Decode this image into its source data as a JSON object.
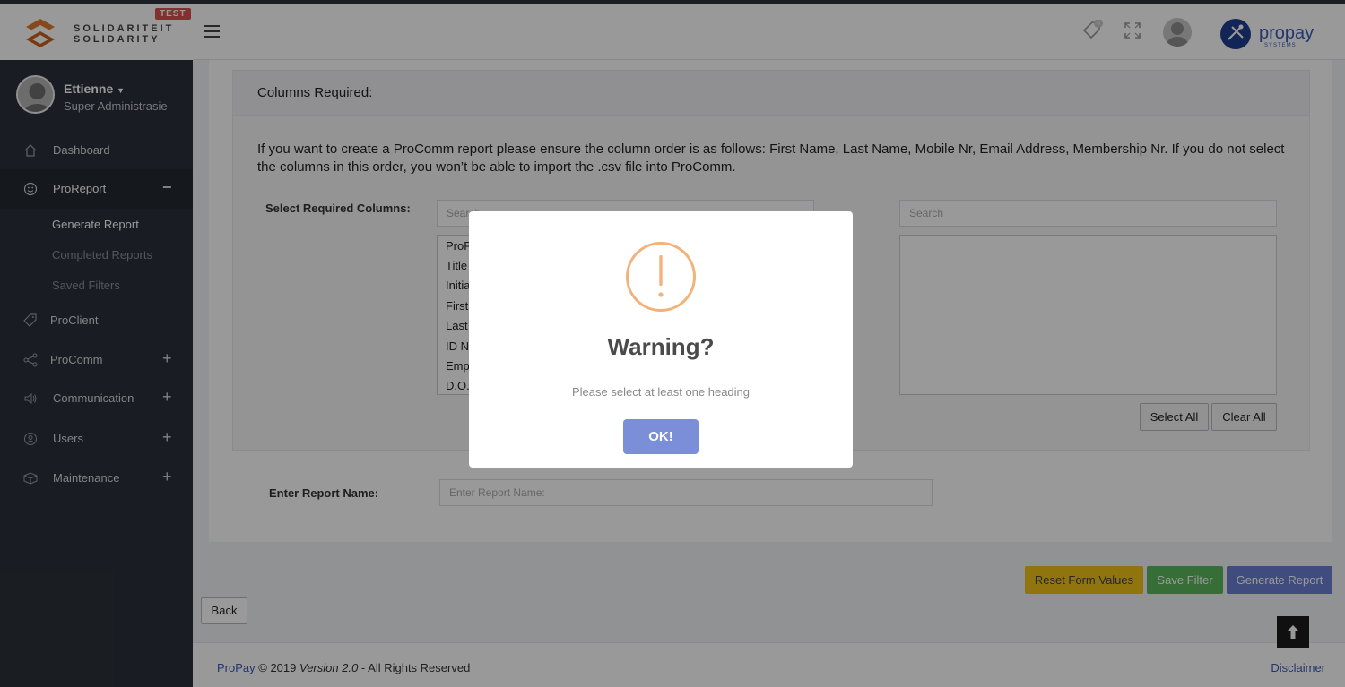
{
  "brand": {
    "line1": "SOLIDARITEIT",
    "line2": "SOLIDARITY",
    "badge": "TEST"
  },
  "header": {
    "notifications_count": "0"
  },
  "user": {
    "name": "Ettienne",
    "role": "Super Administrasie"
  },
  "sidebar": {
    "items": [
      {
        "label": "Dashboard",
        "icon": "home-icon"
      },
      {
        "label": "ProReport",
        "icon": "smile-icon",
        "toggle": "−"
      },
      {
        "label": "ProClient",
        "icon": "tag-icon"
      },
      {
        "label": "ProComm",
        "icon": "share-icon",
        "toggle": "+"
      },
      {
        "label": "Communication",
        "icon": "speaker-icon",
        "toggle": "+"
      },
      {
        "label": "Users",
        "icon": "user-icon",
        "toggle": "+"
      },
      {
        "label": "Maintenance",
        "icon": "box-icon",
        "toggle": "+"
      }
    ],
    "subitems": [
      {
        "label": "Generate Report"
      },
      {
        "label": "Completed Reports"
      },
      {
        "label": "Saved Filters"
      }
    ]
  },
  "form": {
    "panel_title": "Columns Required:",
    "info": "If you want to create a ProComm report please ensure the column order is as follows: First Name, Last Name, Mobile Nr, Email Address, Membership Nr. If you do not select the columns in this order, you won’t be able to import the .csv file into ProComm.",
    "select_label": "Select Required Columns:",
    "left_search_placeholder": "Search",
    "right_search_placeholder": "Search",
    "available_columns": [
      "ProP",
      "Title",
      "Initia",
      "First",
      "Last",
      "ID N",
      "Emp",
      "D.O."
    ],
    "select_all": "Select All",
    "clear_all": "Clear All",
    "report_name_label": "Enter Report Name:",
    "report_name_placeholder": "Enter Report Name:"
  },
  "actions": {
    "reset": "Reset Form Values",
    "save_filter": "Save Filter",
    "generate": "Generate Report",
    "back": "Back"
  },
  "footer": {
    "brand": "ProPay",
    "text": "© 2019",
    "version": "Version 2.0",
    "rights": "- All Rights Reserved",
    "disclaimer": "Disclaimer"
  },
  "modal": {
    "title": "Warning?",
    "message": "Please select at least one heading",
    "ok": "OK!"
  },
  "colors": {
    "sidebar": "#2b3039",
    "warning": "#f2b27a",
    "ok_button": "#7b8fd8",
    "reset_button": "#f0c419",
    "save_button": "#5cb85c",
    "generate_button": "#6a7fd0"
  }
}
